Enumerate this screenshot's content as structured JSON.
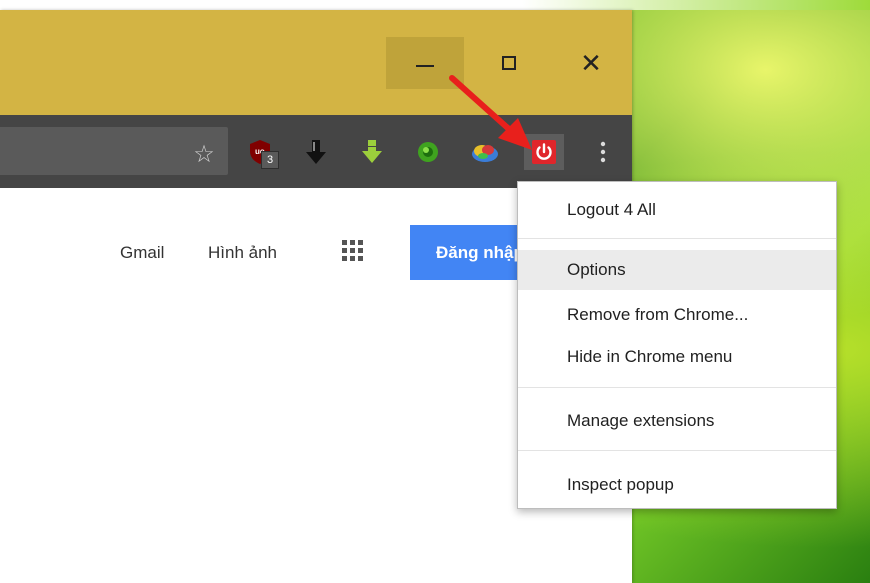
{
  "window": {
    "minimize_label": "–",
    "maximize_label": "☐",
    "close_label": "✕"
  },
  "toolbar": {
    "extensions": [
      {
        "name": "ublock-origin",
        "badge": "3"
      },
      {
        "name": "download-manager"
      },
      {
        "name": "download-green"
      },
      {
        "name": "green-circle"
      },
      {
        "name": "colorful-ext"
      },
      {
        "name": "logout-4-all"
      }
    ]
  },
  "page": {
    "links": [
      "Gmail",
      "Hình ảnh"
    ],
    "signin_label": "Đăng nhập"
  },
  "context_menu": {
    "items": [
      "Logout 4 All",
      "Options",
      "Remove from Chrome...",
      "Hide in Chrome menu",
      "Manage extensions",
      "Inspect popup"
    ],
    "highlighted": "Options"
  },
  "colors": {
    "titlebar": "#d3b444",
    "toolbar": "#454545",
    "accent": "#4285f4",
    "annotation": "#e8201c"
  }
}
